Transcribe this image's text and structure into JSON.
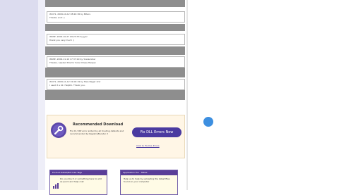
{
  "posts": [
    {
      "meta": "WinT1, 2009-10-12 08:20:36 by Miters",
      "text": "Thanks a lot :)"
    },
    {
      "meta": "WKSE, 2009-10-27 09:23:33 by Jyer",
      "text": "thank you very much :)"
    },
    {
      "meta": "WKSE, 2009-11-10 17:37:29 by Yowlaroider",
      "text": "Thanks, needed this for Solar Chess Harpex"
    },
    {
      "meta": "WinT1, 2009-11-12 01:00:19 by Stan Neger 2nd",
      "text": "I used it a lot. Helpful. Thank you."
    }
  ],
  "promo": {
    "title": "Recommended Download",
    "description": "Fix dll / IRP error added by all trusting defaults and recommended by RegistryBooster 2",
    "button_label": "Fix DLL Errors Now",
    "link_text": "Click to Fix DLL Errors"
  },
  "cards": [
    {
      "header": "Product Rated/Not Like Tags",
      "text": "Do you like it or something here to add as quick and help cost"
    },
    {
      "header": "Application Fun · Mikes",
      "text": "Help us to help by uploading the latest files found on your computer"
    }
  ],
  "colors": {
    "accent": "#4a3aa0",
    "header_gray": "#8e8e8e",
    "cursor": "#3d8fe0"
  }
}
